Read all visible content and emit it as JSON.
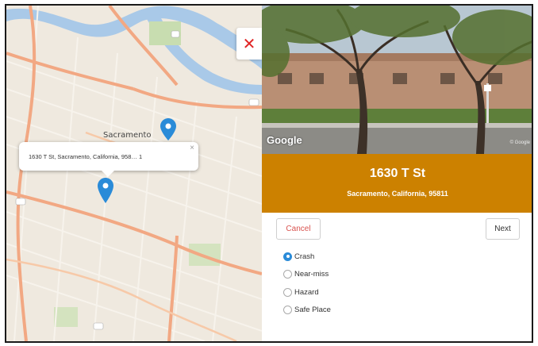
{
  "map": {
    "city_label": "Sacramento",
    "popup_text": "1630 T St, Sacramento, California, 958… 1",
    "popup_close": "×",
    "close_symbol": "✕",
    "marker_color": "#2a8bd8"
  },
  "streetview": {
    "logo": "Google",
    "copyright": "© Google"
  },
  "address": {
    "title": "1630 T St",
    "subtitle": "Sacramento, California, 95811",
    "band_color": "#cc8100"
  },
  "buttons": {
    "cancel": "Cancel",
    "next": "Next"
  },
  "options": [
    {
      "label": "Crash",
      "checked": true
    },
    {
      "label": "Near-miss",
      "checked": false
    },
    {
      "label": "Hazard",
      "checked": false
    },
    {
      "label": "Safe Place",
      "checked": false
    }
  ]
}
